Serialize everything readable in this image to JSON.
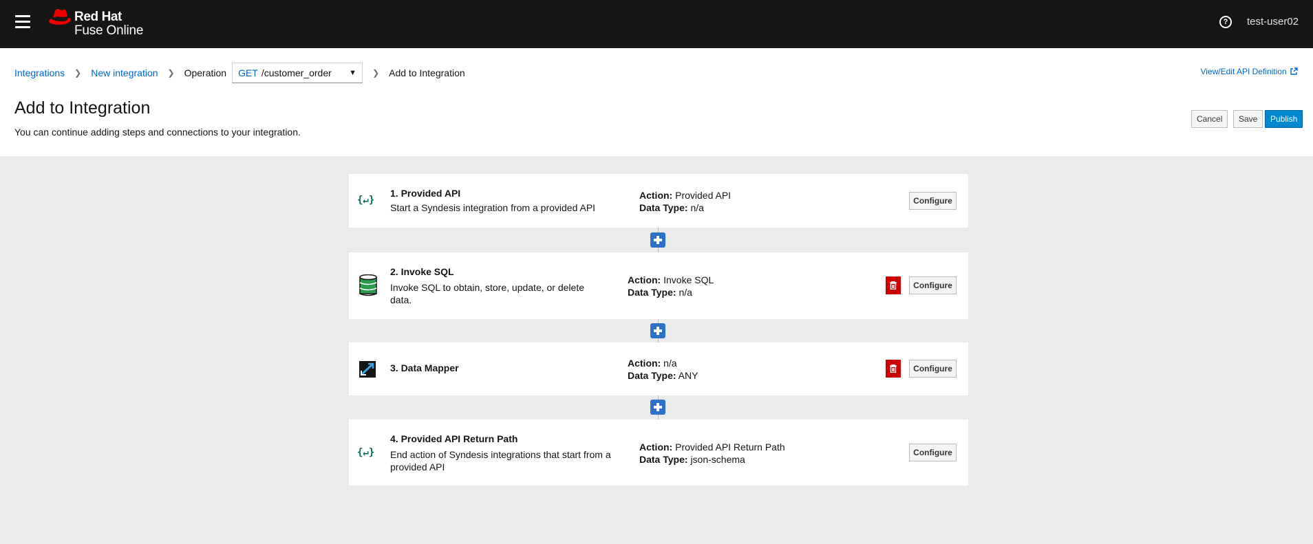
{
  "app": {
    "brand_line1": "Red Hat",
    "brand_line2": "Fuse Online",
    "user": "test-user02"
  },
  "breadcrumb": {
    "items": [
      "Integrations",
      "New integration"
    ],
    "operation_label": "Operation",
    "operation_method": "GET",
    "operation_path": "/customer_order",
    "current": "Add to Integration"
  },
  "header": {
    "view_edit_link": "View/Edit API Definition",
    "title": "Add to Integration",
    "description": "You can continue adding steps and connections to your integration.",
    "cancel_label": "Cancel",
    "save_label": "Save",
    "publish_label": "Publish"
  },
  "labels": {
    "action": "Action:",
    "data_type": "Data Type:",
    "configure": "Configure"
  },
  "steps": [
    {
      "title": "1. Provided API",
      "description": "Start a Syndesis integration from a provided API",
      "action": "Provided API",
      "data_type": "n/a"
    },
    {
      "title": "2. Invoke SQL",
      "description": "Invoke SQL to obtain, store, update, or delete data.",
      "action": "Invoke SQL",
      "data_type": "n/a"
    },
    {
      "title": "3. Data Mapper",
      "description": "",
      "action": "n/a",
      "data_type": "ANY"
    },
    {
      "title": "4. Provided API Return Path",
      "description": "End action of Syndesis integrations that start from a provided API",
      "action": "Provided API Return Path",
      "data_type": "json-schema"
    }
  ],
  "colors": {
    "topbar": "#151515",
    "link": "#0066cc",
    "publish": "#0088ce",
    "delete": "#cc0000",
    "add_step": "#2e71c9"
  },
  "icons": [
    "hamburger-icon",
    "redhat-logo-icon",
    "help-icon",
    "external-link-icon",
    "api-icon",
    "database-icon",
    "data-mapper-icon",
    "trash-icon",
    "plus-icon"
  ]
}
